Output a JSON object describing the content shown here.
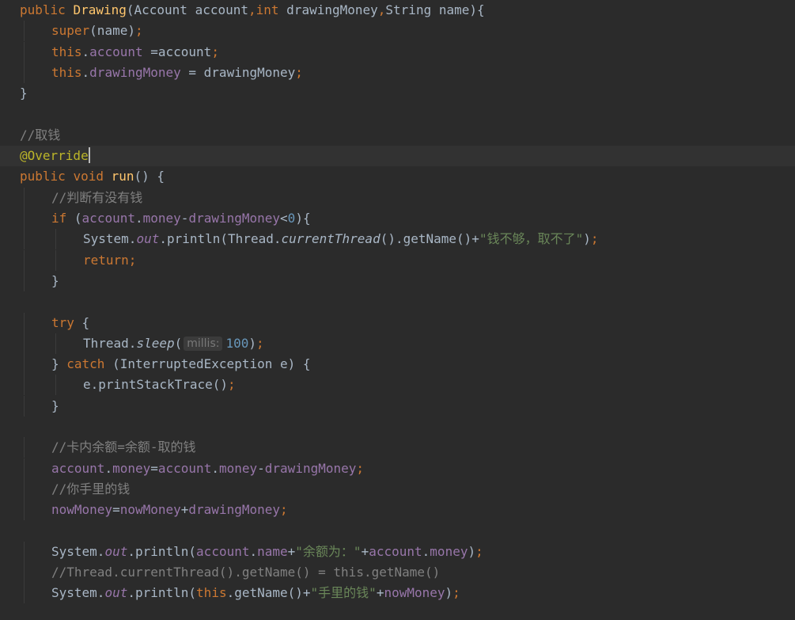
{
  "editor": {
    "lines": [
      {
        "tokens": [
          {
            "t": "public ",
            "c": "k"
          },
          {
            "t": "Drawing",
            "c": "m"
          },
          {
            "t": "(Account account"
          },
          {
            "t": ",",
            "c": "k"
          },
          {
            "t": "int ",
            "c": "k"
          },
          {
            "t": "drawingMoney"
          },
          {
            "t": ",",
            "c": "k"
          },
          {
            "t": "String name){"
          }
        ]
      },
      {
        "indent": 1,
        "tokens": [
          {
            "t": "super",
            "c": "k"
          },
          {
            "t": "(name)"
          },
          {
            "t": ";",
            "c": "k"
          }
        ]
      },
      {
        "indent": 1,
        "tokens": [
          {
            "t": "this",
            "c": "k"
          },
          {
            "t": "."
          },
          {
            "t": "account",
            "c": "f"
          },
          {
            "t": " =account"
          },
          {
            "t": ";",
            "c": "k"
          }
        ]
      },
      {
        "indent": 1,
        "tokens": [
          {
            "t": "this",
            "c": "k"
          },
          {
            "t": "."
          },
          {
            "t": "drawingMoney",
            "c": "f"
          },
          {
            "t": " = drawingMoney"
          },
          {
            "t": ";",
            "c": "k"
          }
        ]
      },
      {
        "tokens": [
          {
            "t": "}"
          }
        ]
      },
      {
        "tokens": []
      },
      {
        "tokens": [
          {
            "t": "//取钱",
            "c": "c"
          }
        ]
      },
      {
        "current": true,
        "caret_after": true,
        "tokens": [
          {
            "t": "@Override",
            "c": "a"
          }
        ]
      },
      {
        "tokens": [
          {
            "t": "public ",
            "c": "k"
          },
          {
            "t": "void ",
            "c": "k"
          },
          {
            "t": "run",
            "c": "m"
          },
          {
            "t": "() {"
          }
        ]
      },
      {
        "indent": 1,
        "tokens": [
          {
            "t": "//判断有没有钱",
            "c": "c"
          }
        ]
      },
      {
        "indent": 1,
        "tokens": [
          {
            "t": "if ",
            "c": "k"
          },
          {
            "t": "("
          },
          {
            "t": "account",
            "c": "f"
          },
          {
            "t": "."
          },
          {
            "t": "money",
            "c": "f"
          },
          {
            "t": "-"
          },
          {
            "t": "drawingMoney",
            "c": "f"
          },
          {
            "t": "<"
          },
          {
            "t": "0",
            "c": "n"
          },
          {
            "t": "){"
          }
        ]
      },
      {
        "indent": 2,
        "tokens": [
          {
            "t": "System."
          },
          {
            "t": "out",
            "c": "fi"
          },
          {
            "t": ".println(Thread."
          },
          {
            "t": "currentThread",
            "c": "it"
          },
          {
            "t": "().getName()+"
          },
          {
            "t": "\"钱不够，取不了\"",
            "c": "s"
          },
          {
            "t": ")"
          },
          {
            "t": ";",
            "c": "k"
          }
        ]
      },
      {
        "indent": 2,
        "tokens": [
          {
            "t": "return;",
            "c": "k"
          }
        ]
      },
      {
        "indent": 1,
        "tokens": [
          {
            "t": "}"
          }
        ]
      },
      {
        "tokens": []
      },
      {
        "indent": 1,
        "tokens": [
          {
            "t": "try ",
            "c": "k"
          },
          {
            "t": "{"
          }
        ]
      },
      {
        "indent": 2,
        "tokens": [
          {
            "t": "Thread."
          },
          {
            "t": "sleep",
            "c": "it"
          },
          {
            "t": "("
          },
          {
            "hint": "millis:"
          },
          {
            "t": "100",
            "c": "n"
          },
          {
            "t": ")"
          },
          {
            "t": ";",
            "c": "k"
          }
        ]
      },
      {
        "indent": 1,
        "tokens": [
          {
            "t": "} "
          },
          {
            "t": "catch ",
            "c": "k"
          },
          {
            "t": "(InterruptedException e) {"
          }
        ]
      },
      {
        "indent": 2,
        "tokens": [
          {
            "t": "e.printStackTrace()"
          },
          {
            "t": ";",
            "c": "k"
          }
        ]
      },
      {
        "indent": 1,
        "tokens": [
          {
            "t": "}"
          }
        ]
      },
      {
        "tokens": []
      },
      {
        "indent": 1,
        "tokens": [
          {
            "t": "//卡内余额=余额-取的钱",
            "c": "c"
          }
        ]
      },
      {
        "indent": 1,
        "tokens": [
          {
            "t": "account",
            "c": "f"
          },
          {
            "t": "."
          },
          {
            "t": "money",
            "c": "f"
          },
          {
            "t": "="
          },
          {
            "t": "account",
            "c": "f"
          },
          {
            "t": "."
          },
          {
            "t": "money",
            "c": "f"
          },
          {
            "t": "-"
          },
          {
            "t": "drawingMoney",
            "c": "f"
          },
          {
            "t": ";",
            "c": "k"
          }
        ]
      },
      {
        "indent": 1,
        "tokens": [
          {
            "t": "//你手里的钱",
            "c": "c"
          }
        ]
      },
      {
        "indent": 1,
        "tokens": [
          {
            "t": "nowMoney",
            "c": "f"
          },
          {
            "t": "="
          },
          {
            "t": "nowMoney",
            "c": "f"
          },
          {
            "t": "+"
          },
          {
            "t": "drawingMoney",
            "c": "f"
          },
          {
            "t": ";",
            "c": "k"
          }
        ]
      },
      {
        "tokens": []
      },
      {
        "indent": 1,
        "tokens": [
          {
            "t": "System."
          },
          {
            "t": "out",
            "c": "fi"
          },
          {
            "t": ".println("
          },
          {
            "t": "account",
            "c": "f"
          },
          {
            "t": "."
          },
          {
            "t": "name",
            "c": "f"
          },
          {
            "t": "+"
          },
          {
            "t": "\"余额为：\"",
            "c": "s"
          },
          {
            "t": "+"
          },
          {
            "t": "account",
            "c": "f"
          },
          {
            "t": "."
          },
          {
            "t": "money",
            "c": "f"
          },
          {
            "t": ")"
          },
          {
            "t": ";",
            "c": "k"
          }
        ]
      },
      {
        "indent": 1,
        "tokens": [
          {
            "t": "//Thread.currentThread().getName() = this.getName()",
            "c": "c"
          }
        ]
      },
      {
        "indent": 1,
        "tokens": [
          {
            "t": "System."
          },
          {
            "t": "out",
            "c": "fi"
          },
          {
            "t": ".println("
          },
          {
            "t": "this",
            "c": "k"
          },
          {
            "t": ".getName()+"
          },
          {
            "t": "\"手里的钱\"",
            "c": "s"
          },
          {
            "t": "+"
          },
          {
            "t": "nowMoney",
            "c": "f"
          },
          {
            "t": ")"
          },
          {
            "t": ";",
            "c": "k"
          }
        ]
      },
      {
        "tokens": []
      }
    ]
  },
  "theme": {
    "background": "#2b2b2b",
    "current_line": "#323232",
    "default_text": "#a9b7c6",
    "keyword": "#cc7832",
    "field": "#9876aa",
    "comment": "#808080",
    "string": "#6a8759",
    "number": "#6897bb",
    "method_declaration": "#ffc66d",
    "annotation": "#bbb529"
  }
}
